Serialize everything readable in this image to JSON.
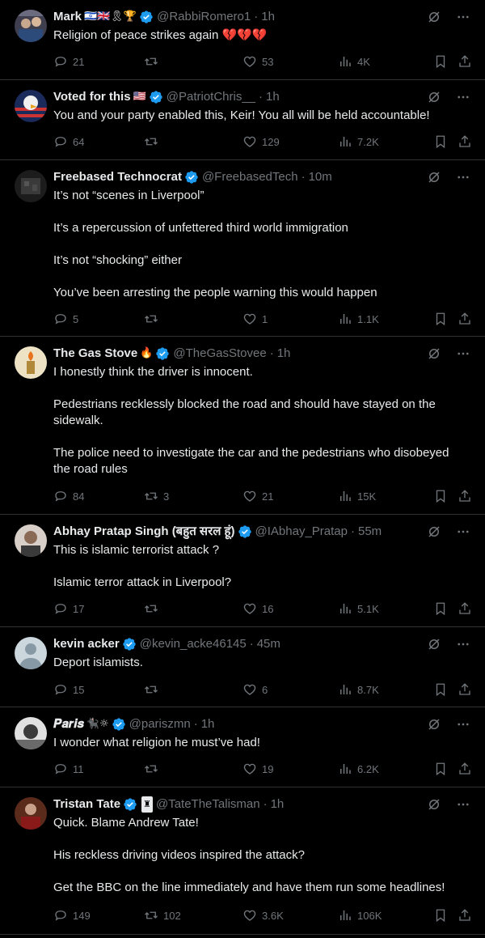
{
  "tweets": [
    {
      "name": "Mark",
      "emoji": "🇮🇱🇬🇧🎗🏆",
      "handle": "@RabbiRomero1",
      "time": "1h",
      "lines": [
        "Religion of peace strikes again 💔💔💔"
      ],
      "replies": "21",
      "reposts": "",
      "likes": "53",
      "views": "4K",
      "avatar_color": "#5a5a6a"
    },
    {
      "name": "Voted for this",
      "emoji": "🇺🇸",
      "handle": "@PatriotChris__",
      "time": "1h",
      "lines": [
        "You and your party enabled this, Keir! You all will be held accountable!"
      ],
      "replies": "64",
      "reposts": "",
      "likes": "129",
      "views": "7.2K",
      "avatar_color": "#b33a3a"
    },
    {
      "name": "Freebased Technocrat",
      "emoji": "",
      "handle": "@FreebasedTech",
      "time": "10m",
      "lines": [
        "It’s not “scenes in Liverpool”",
        "It’s a repercussion of unfettered third world immigration",
        "It’s not “shocking” either",
        "You’ve been arresting the people warning this would happen"
      ],
      "replies": "5",
      "reposts": "",
      "likes": "1",
      "views": "1.1K",
      "avatar_color": "#2a2a2a"
    },
    {
      "name": "The Gas Stove",
      "emoji": "🔥",
      "handle": "@TheGasStovee",
      "time": "1h",
      "lines": [
        "I honestly think the driver is innocent.",
        "Pedestrians recklessly blocked the road and should have stayed on the sidewalk.",
        "The police need to investigate the car and the pedestrians who disobeyed the road rules"
      ],
      "replies": "84",
      "reposts": "3",
      "likes": "21",
      "views": "15K",
      "avatar_color": "#e8d8b0"
    },
    {
      "name": "Abhay Pratap Singh (बहुत सरल हूं)",
      "emoji": "",
      "handle": "@IAbhay_Pratap",
      "time": "55m",
      "lines": [
        "This is islamic terrorist attack ?",
        "Islamic terror attack in Liverpool?"
      ],
      "replies": "17",
      "reposts": "",
      "likes": "16",
      "views": "5.1K",
      "avatar_color": "#8a6a55"
    },
    {
      "name": "kevin acker",
      "emoji": "",
      "handle": "@kevin_acke46145",
      "time": "45m",
      "lines": [
        "Deport islamists."
      ],
      "replies": "15",
      "reposts": "",
      "likes": "6",
      "views": "8.7K",
      "avatar_color": "#ccd6dd"
    },
    {
      "name": "𝑷𝒂𝒓𝒊𝒔",
      "emoji": "🐈‍⬛☼",
      "handle": "@pariszmn",
      "time": "1h",
      "lines": [
        "I wonder what religion he must’ve had!"
      ],
      "replies": "11",
      "reposts": "",
      "likes": "19",
      "views": "6.2K",
      "avatar_color": "#d9d9d9"
    },
    {
      "name": "Tristan Tate",
      "emoji": "♜",
      "handle": "@TateTheTalisman",
      "time": "1h",
      "lines": [
        "Quick. Blame Andrew Tate!",
        "His reckless driving videos inspired the attack?",
        "Get the BBC on the line immediately and have them run some headlines!"
      ],
      "replies": "149",
      "reposts": "102",
      "likes": "3.6K",
      "views": "106K",
      "avatar_color": "#7a3a2a"
    }
  ],
  "colors": {
    "background": "#000000",
    "text": "#e7e9ea",
    "muted": "#71767b",
    "verified": "#1d9bf0",
    "divider": "#2f3336"
  }
}
